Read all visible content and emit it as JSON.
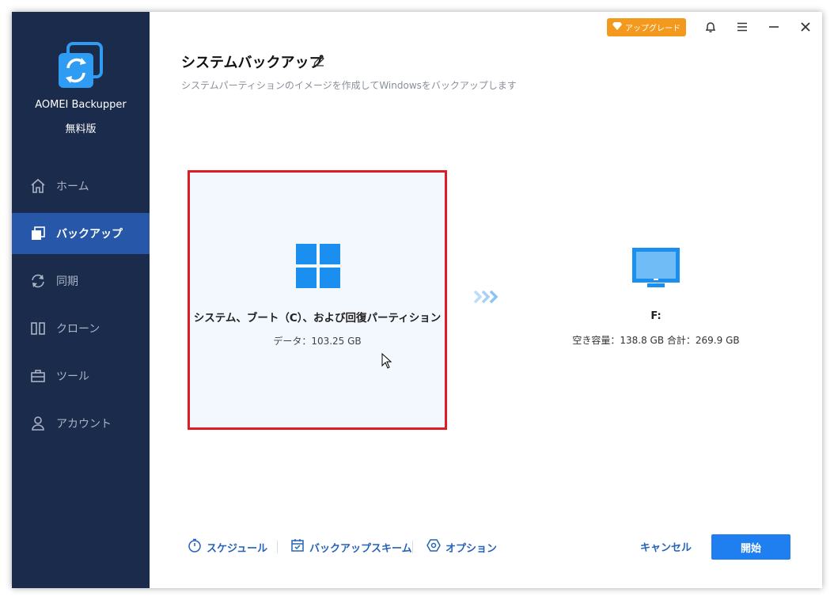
{
  "app": {
    "name": "AOMEI Backupper",
    "edition": "無料版"
  },
  "sidebar": {
    "items": [
      {
        "label": "ホーム",
        "icon": "home-icon"
      },
      {
        "label": "バックアップ",
        "icon": "backup-icon",
        "active": true
      },
      {
        "label": "同期",
        "icon": "sync-icon"
      },
      {
        "label": "クローン",
        "icon": "clone-icon"
      },
      {
        "label": "ツール",
        "icon": "tools-icon"
      },
      {
        "label": "アカウント",
        "icon": "account-icon"
      }
    ]
  },
  "titlebar": {
    "upgrade_label": "アップグレード"
  },
  "page": {
    "title": "システムバックアップ",
    "subtitle": "システムパーティションのイメージを作成してWindowsをバックアップします"
  },
  "source": {
    "name": "システム、ブート（C）、および回復パーティション",
    "data": "データ：103.25 GB"
  },
  "destination": {
    "name": "F:",
    "space": "空き容量：138.8 GB 合計：269.9 GB"
  },
  "bottom": {
    "schedule": "スケジュール",
    "scheme": "バックアップスキーム",
    "options": "オプション",
    "cancel": "キャンセル",
    "start": "開始"
  },
  "colors": {
    "sidebar_bg": "#1a2b4c",
    "active_nav": "#2657a8",
    "accent": "#1f7ff0",
    "upgrade": "#f39a1e",
    "selection_border": "#e01b24"
  }
}
